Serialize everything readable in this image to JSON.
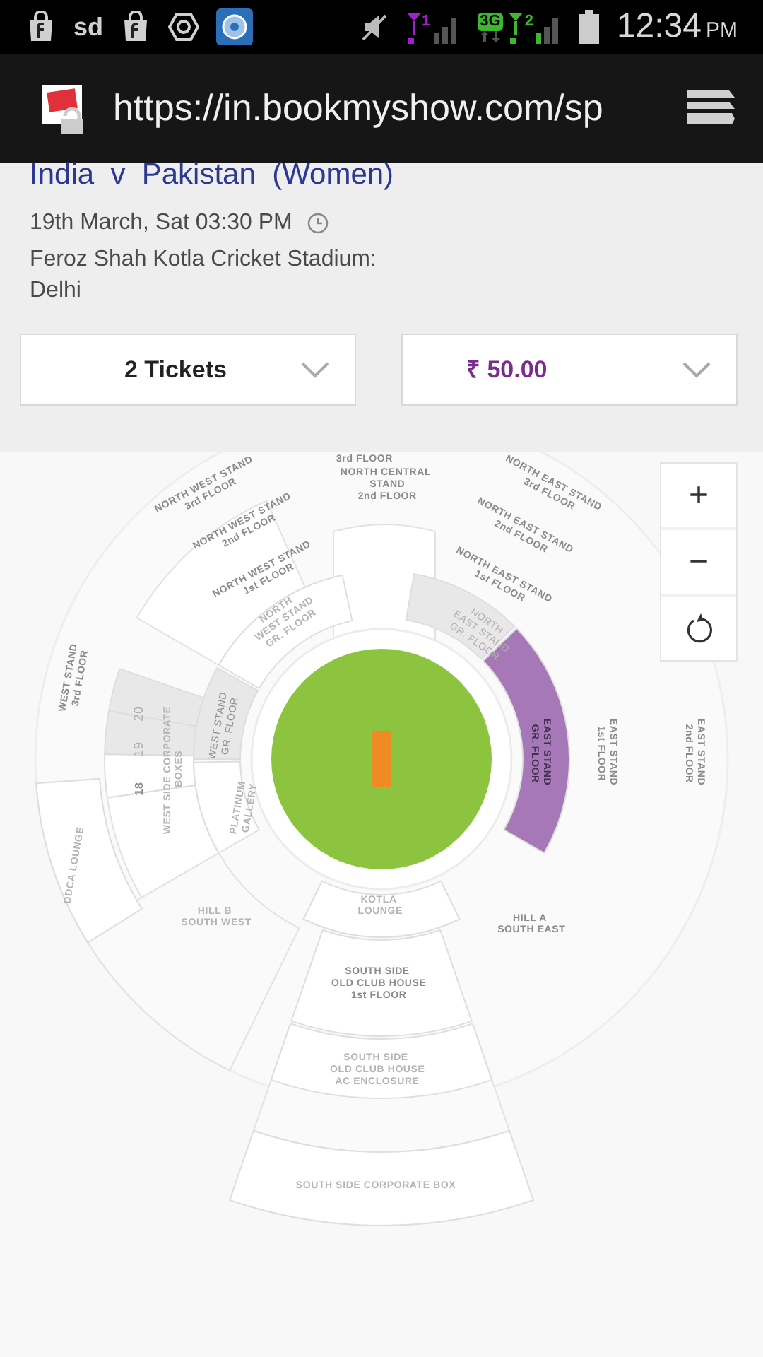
{
  "status_bar": {
    "sd": "sd",
    "sim1": "1",
    "network": "3G",
    "sim2": "2",
    "time": "12:34",
    "ampm": "PM"
  },
  "browser": {
    "url": "https://in.bookmyshow.com/sp"
  },
  "event": {
    "title": "India  v  Pakistan  (Women)",
    "datetime": "19th March, Sat 03:30 PM",
    "venue": "Feroz Shah Kotla Cricket Stadium: Delhi"
  },
  "tickets": {
    "value": "2 Tickets"
  },
  "price": {
    "value": "₹ 50.00"
  },
  "zoom_controls": [
    "+",
    "−"
  ],
  "sections": [
    {
      "lines": [
        "3rd FLOOR"
      ],
      "available": true,
      "sold_out": false,
      "selected": false
    },
    {
      "lines": [
        "NORTH CENTRAL",
        "STAND",
        "2nd FLOOR"
      ],
      "available": true,
      "sold_out": false,
      "selected": false
    },
    {
      "lines": [
        "NORTH WEST STAND",
        "3rd FLOOR"
      ],
      "available": true,
      "sold_out": false,
      "selected": false
    },
    {
      "lines": [
        "NORTH WEST STAND",
        "2nd FLOOR"
      ],
      "available": true,
      "sold_out": false,
      "selected": false
    },
    {
      "lines": [
        "NORTH WEST STAND",
        "1st FLOOR"
      ],
      "available": true,
      "sold_out": false,
      "selected": false
    },
    {
      "lines": [
        "NORTH",
        "WEST STAND",
        "GR. FLOOR"
      ],
      "available": false,
      "sold_out": false,
      "selected": false
    },
    {
      "lines": [
        "NORTH EAST STAND",
        "3rd FLOOR"
      ],
      "available": true,
      "sold_out": false,
      "selected": false
    },
    {
      "lines": [
        "NORTH EAST STAND",
        "2nd FLOOR"
      ],
      "available": true,
      "sold_out": false,
      "selected": false
    },
    {
      "lines": [
        "NORTH EAST STAND",
        "1st FLOOR"
      ],
      "available": true,
      "sold_out": false,
      "selected": false
    },
    {
      "lines": [
        "NORTH",
        "EAST STAND",
        "GR. FLOOR"
      ],
      "available": false,
      "sold_out": true,
      "selected": false
    },
    {
      "lines": [
        "WEST STAND",
        "3rd FLOOR"
      ],
      "available": true,
      "sold_out": false,
      "selected": false
    },
    {
      "lines": [
        "20"
      ],
      "available": false,
      "sold_out": true,
      "selected": false
    },
    {
      "lines": [
        "19"
      ],
      "available": false,
      "sold_out": true,
      "selected": false
    },
    {
      "lines": [
        "18"
      ],
      "available": true,
      "sold_out": false,
      "selected": false
    },
    {
      "lines": [
        "WEST SIDE CORPORATE",
        "BOXES"
      ],
      "available": false,
      "sold_out": false,
      "selected": false
    },
    {
      "lines": [
        "WEST STAND",
        "GR. FLOOR"
      ],
      "available": true,
      "sold_out": true,
      "selected": false
    },
    {
      "lines": [
        "PLATINUM",
        "GALLERY"
      ],
      "available": false,
      "sold_out": false,
      "selected": false
    },
    {
      "lines": [
        "DDCA LOUNGE"
      ],
      "available": false,
      "sold_out": false,
      "selected": false
    },
    {
      "lines": [
        "HILL B",
        "SOUTH WEST"
      ],
      "available": false,
      "sold_out": false,
      "selected": false
    },
    {
      "lines": [
        "EAST STAND",
        "GR. FLOOR"
      ],
      "available": true,
      "sold_out": false,
      "selected": true
    },
    {
      "lines": [
        "EAST STAND",
        "1st FLOOR"
      ],
      "available": true,
      "sold_out": false,
      "selected": false
    },
    {
      "lines": [
        "EAST STAND",
        "2nd FLOOR"
      ],
      "available": true,
      "sold_out": false,
      "selected": false
    },
    {
      "lines": [
        "KOTLA",
        "LOUNGE"
      ],
      "available": false,
      "sold_out": false,
      "selected": false
    },
    {
      "lines": [
        "HILL A",
        "SOUTH EAST"
      ],
      "available": true,
      "sold_out": false,
      "selected": false
    },
    {
      "lines": [
        "SOUTH SIDE",
        "OLD CLUB HOUSE",
        "1st FLOOR"
      ],
      "available": true,
      "sold_out": false,
      "selected": false
    },
    {
      "lines": [
        "SOUTH SIDE",
        "OLD CLUB HOUSE",
        "AC ENCLOSURE"
      ],
      "available": false,
      "sold_out": false,
      "selected": false
    },
    {
      "lines": [
        "SOUTH SIDE CORPORATE BOX"
      ],
      "available": false,
      "sold_out": false,
      "selected": false
    }
  ]
}
